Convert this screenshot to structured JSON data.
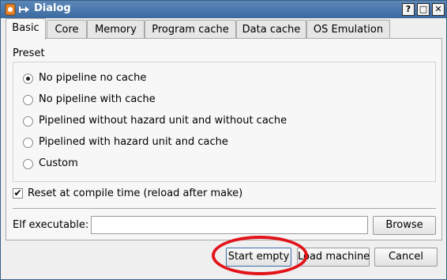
{
  "window": {
    "title": "Dialog",
    "title_buttons": {
      "help": "?",
      "maximize": "□",
      "close": "✕"
    }
  },
  "tabs": [
    {
      "label": "Basic",
      "active": true
    },
    {
      "label": "Core"
    },
    {
      "label": "Memory"
    },
    {
      "label": "Program cache"
    },
    {
      "label": "Data cache"
    },
    {
      "label": "OS Emulation"
    }
  ],
  "basic": {
    "preset_label": "Preset",
    "presets": [
      {
        "label": "No pipeline no cache",
        "checked": true
      },
      {
        "label": "No pipeline with cache"
      },
      {
        "label": "Pipelined without hazard unit and without cache"
      },
      {
        "label": "Pipelined with hazard unit and cache"
      },
      {
        "label": "Custom"
      }
    ],
    "reset_label": "Reset at compile time (reload after make)",
    "reset_checked": true,
    "elf_label": "Elf executable:",
    "elf_value": "",
    "browse_label": "Browse"
  },
  "footer": {
    "start_empty": "Start empty",
    "load_machine": "Load machine",
    "cancel": "Cancel"
  },
  "colors": {
    "titlebar": "#4a78ad",
    "annotation": "#e2141a"
  }
}
